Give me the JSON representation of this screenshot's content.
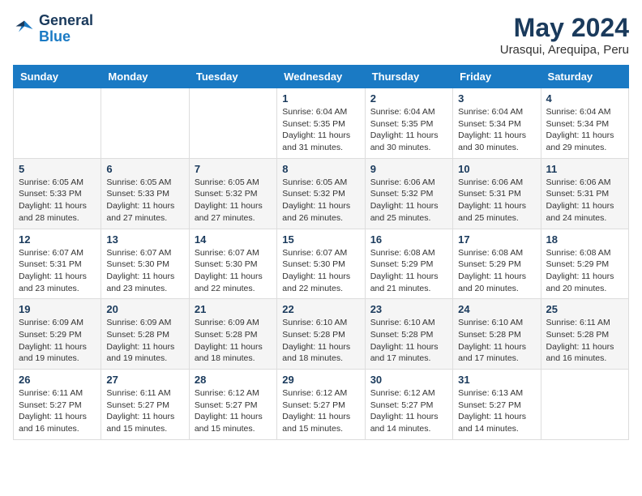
{
  "header": {
    "logo": {
      "line1": "General",
      "line2": "Blue"
    },
    "title": "May 2024",
    "location": "Urasqui, Arequipa, Peru"
  },
  "weekdays": [
    "Sunday",
    "Monday",
    "Tuesday",
    "Wednesday",
    "Thursday",
    "Friday",
    "Saturday"
  ],
  "weeks": [
    [
      null,
      null,
      null,
      {
        "day": 1,
        "sunrise": "6:04 AM",
        "sunset": "5:35 PM",
        "daylight": "11 hours and 31 minutes."
      },
      {
        "day": 2,
        "sunrise": "6:04 AM",
        "sunset": "5:35 PM",
        "daylight": "11 hours and 30 minutes."
      },
      {
        "day": 3,
        "sunrise": "6:04 AM",
        "sunset": "5:34 PM",
        "daylight": "11 hours and 30 minutes."
      },
      {
        "day": 4,
        "sunrise": "6:04 AM",
        "sunset": "5:34 PM",
        "daylight": "11 hours and 29 minutes."
      }
    ],
    [
      {
        "day": 5,
        "sunrise": "6:05 AM",
        "sunset": "5:33 PM",
        "daylight": "11 hours and 28 minutes."
      },
      {
        "day": 6,
        "sunrise": "6:05 AM",
        "sunset": "5:33 PM",
        "daylight": "11 hours and 27 minutes."
      },
      {
        "day": 7,
        "sunrise": "6:05 AM",
        "sunset": "5:32 PM",
        "daylight": "11 hours and 27 minutes."
      },
      {
        "day": 8,
        "sunrise": "6:05 AM",
        "sunset": "5:32 PM",
        "daylight": "11 hours and 26 minutes."
      },
      {
        "day": 9,
        "sunrise": "6:06 AM",
        "sunset": "5:32 PM",
        "daylight": "11 hours and 25 minutes."
      },
      {
        "day": 10,
        "sunrise": "6:06 AM",
        "sunset": "5:31 PM",
        "daylight": "11 hours and 25 minutes."
      },
      {
        "day": 11,
        "sunrise": "6:06 AM",
        "sunset": "5:31 PM",
        "daylight": "11 hours and 24 minutes."
      }
    ],
    [
      {
        "day": 12,
        "sunrise": "6:07 AM",
        "sunset": "5:31 PM",
        "daylight": "11 hours and 23 minutes."
      },
      {
        "day": 13,
        "sunrise": "6:07 AM",
        "sunset": "5:30 PM",
        "daylight": "11 hours and 23 minutes."
      },
      {
        "day": 14,
        "sunrise": "6:07 AM",
        "sunset": "5:30 PM",
        "daylight": "11 hours and 22 minutes."
      },
      {
        "day": 15,
        "sunrise": "6:07 AM",
        "sunset": "5:30 PM",
        "daylight": "11 hours and 22 minutes."
      },
      {
        "day": 16,
        "sunrise": "6:08 AM",
        "sunset": "5:29 PM",
        "daylight": "11 hours and 21 minutes."
      },
      {
        "day": 17,
        "sunrise": "6:08 AM",
        "sunset": "5:29 PM",
        "daylight": "11 hours and 20 minutes."
      },
      {
        "day": 18,
        "sunrise": "6:08 AM",
        "sunset": "5:29 PM",
        "daylight": "11 hours and 20 minutes."
      }
    ],
    [
      {
        "day": 19,
        "sunrise": "6:09 AM",
        "sunset": "5:29 PM",
        "daylight": "11 hours and 19 minutes."
      },
      {
        "day": 20,
        "sunrise": "6:09 AM",
        "sunset": "5:28 PM",
        "daylight": "11 hours and 19 minutes."
      },
      {
        "day": 21,
        "sunrise": "6:09 AM",
        "sunset": "5:28 PM",
        "daylight": "11 hours and 18 minutes."
      },
      {
        "day": 22,
        "sunrise": "6:10 AM",
        "sunset": "5:28 PM",
        "daylight": "11 hours and 18 minutes."
      },
      {
        "day": 23,
        "sunrise": "6:10 AM",
        "sunset": "5:28 PM",
        "daylight": "11 hours and 17 minutes."
      },
      {
        "day": 24,
        "sunrise": "6:10 AM",
        "sunset": "5:28 PM",
        "daylight": "11 hours and 17 minutes."
      },
      {
        "day": 25,
        "sunrise": "6:11 AM",
        "sunset": "5:28 PM",
        "daylight": "11 hours and 16 minutes."
      }
    ],
    [
      {
        "day": 26,
        "sunrise": "6:11 AM",
        "sunset": "5:27 PM",
        "daylight": "11 hours and 16 minutes."
      },
      {
        "day": 27,
        "sunrise": "6:11 AM",
        "sunset": "5:27 PM",
        "daylight": "11 hours and 15 minutes."
      },
      {
        "day": 28,
        "sunrise": "6:12 AM",
        "sunset": "5:27 PM",
        "daylight": "11 hours and 15 minutes."
      },
      {
        "day": 29,
        "sunrise": "6:12 AM",
        "sunset": "5:27 PM",
        "daylight": "11 hours and 15 minutes."
      },
      {
        "day": 30,
        "sunrise": "6:12 AM",
        "sunset": "5:27 PM",
        "daylight": "11 hours and 14 minutes."
      },
      {
        "day": 31,
        "sunrise": "6:13 AM",
        "sunset": "5:27 PM",
        "daylight": "11 hours and 14 minutes."
      },
      null
    ]
  ]
}
